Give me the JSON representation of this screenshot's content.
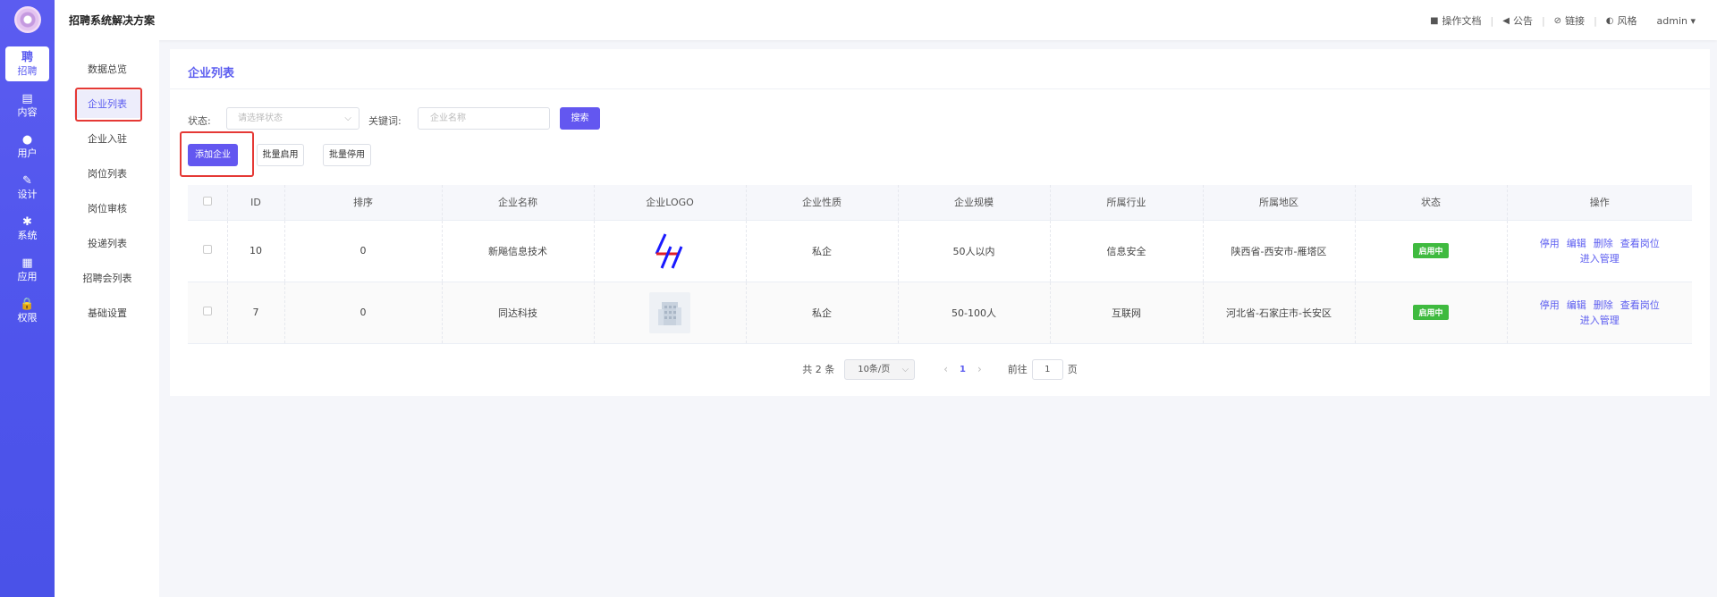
{
  "app": {
    "title": "招聘系统解决方案"
  },
  "rail": {
    "items": [
      {
        "icon": "聘",
        "label": "招聘",
        "active": true
      },
      {
        "icon": "▤",
        "label": "内容"
      },
      {
        "icon": "●",
        "label": "用户"
      },
      {
        "icon": "✎",
        "label": "设计"
      },
      {
        "icon": "✱",
        "label": "系统"
      },
      {
        "icon": "▦",
        "label": "应用"
      },
      {
        "icon": "🔒",
        "label": "权限"
      }
    ]
  },
  "topbar": {
    "links": [
      {
        "icon": "folder-icon",
        "glyph": "■",
        "label": "操作文档"
      },
      {
        "icon": "announcement-icon",
        "glyph": "◀",
        "label": "公告"
      },
      {
        "icon": "link-icon",
        "glyph": "⊘",
        "label": "链接"
      },
      {
        "icon": "palette-icon",
        "glyph": "◐",
        "label": "风格"
      }
    ],
    "separator": "|",
    "admin": "admin ▾"
  },
  "submenu": {
    "items": [
      "数据总览",
      "企业列表",
      "企业入驻",
      "岗位列表",
      "岗位审核",
      "投递列表",
      "招聘会列表",
      "基础设置"
    ],
    "active_index": 1
  },
  "panel": {
    "title": "企业列表",
    "filters": {
      "status_label": "状态:",
      "status_placeholder": "请选择状态",
      "keyword_label": "关键词:",
      "keyword_placeholder": "企业名称",
      "search_label": "搜索"
    },
    "actions": {
      "add": "添加企业",
      "enable": "批量启用",
      "disable": "批量停用"
    }
  },
  "table": {
    "columns": [
      "",
      "ID",
      "排序",
      "企业名称",
      "企业LOGO",
      "企业性质",
      "企业规模",
      "所属行业",
      "所属地区",
      "状态",
      "操作"
    ],
    "rows": [
      {
        "id": "10",
        "sort": "0",
        "name": "新飚信息技术",
        "logo": "slash-logo",
        "nature": "私企",
        "size": "50人以内",
        "industry": "信息安全",
        "region": "陕西省-西安市-雁塔区",
        "status": "启用中"
      },
      {
        "id": "7",
        "sort": "0",
        "name": "同达科技",
        "logo": "building-logo",
        "nature": "私企",
        "size": "50-100人",
        "industry": "互联网",
        "region": "河北省-石家庄市-长安区",
        "status": "启用中"
      }
    ],
    "ops": [
      "停用",
      "编辑",
      "删除",
      "查看岗位",
      "进入管理"
    ]
  },
  "pagination": {
    "total": "共 2 条",
    "page_size": "10条/页",
    "current": "1",
    "goto_label": "前往",
    "goto_value": "1",
    "page_unit": "页"
  },
  "colors": {
    "accent": "#5b5cf0",
    "badge": "#3fba3f",
    "highlight": "#e53935"
  }
}
